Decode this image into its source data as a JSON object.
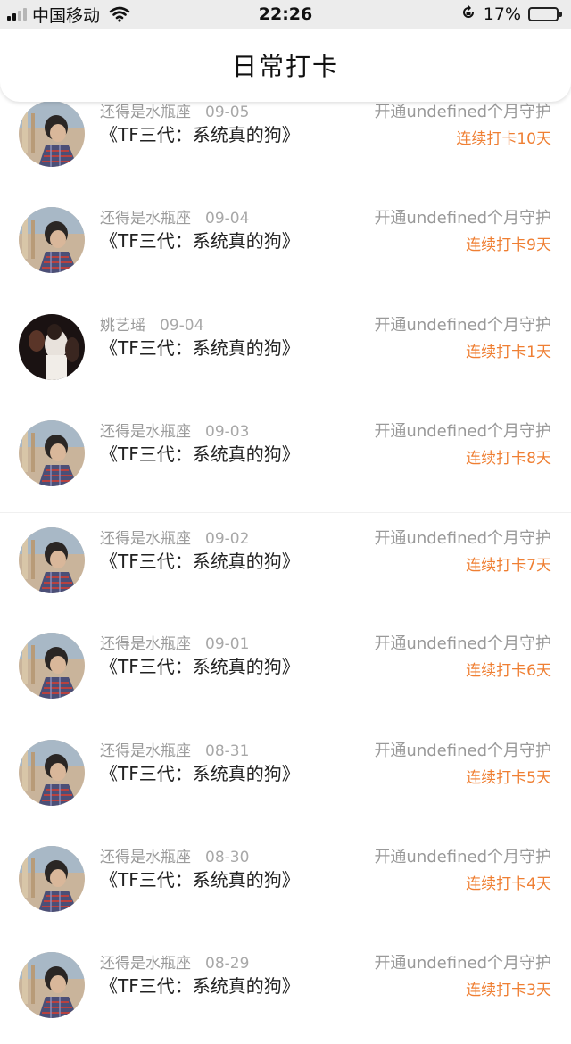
{
  "status_bar": {
    "carrier": "中国移动",
    "time": "22:26",
    "battery": "17%",
    "battery_level": 0.17
  },
  "header": {
    "title": "日常打卡"
  },
  "checkins": [
    {
      "user": "还得是水瓶座",
      "date": "09-05",
      "book": "《TF三代：系统真的狗》",
      "guard": "开通undefined个月守护",
      "streak": "连续打卡10天",
      "avatar": "avatar-photo-boy"
    },
    {
      "user": "还得是水瓶座",
      "date": "09-04",
      "book": "《TF三代：系统真的狗》",
      "guard": "开通undefined个月守护",
      "streak": "连续打卡9天",
      "avatar": "avatar-photo-boy"
    },
    {
      "user": "姚艺瑶",
      "date": "09-04",
      "book": "《TF三代：系统真的狗》",
      "guard": "开通undefined个月守护",
      "streak": "连续打卡1天",
      "avatar": "avatar-photo-dark"
    },
    {
      "user": "还得是水瓶座",
      "date": "09-03",
      "book": "《TF三代：系统真的狗》",
      "guard": "开通undefined个月守护",
      "streak": "连续打卡8天",
      "avatar": "avatar-photo-boy"
    },
    {
      "user": "还得是水瓶座",
      "date": "09-02",
      "book": "《TF三代：系统真的狗》",
      "guard": "开通undefined个月守护",
      "streak": "连续打卡7天",
      "avatar": "avatar-photo-boy"
    },
    {
      "user": "还得是水瓶座",
      "date": "09-01",
      "book": "《TF三代：系统真的狗》",
      "guard": "开通undefined个月守护",
      "streak": "连续打卡6天",
      "avatar": "avatar-photo-boy"
    },
    {
      "user": "还得是水瓶座",
      "date": "08-31",
      "book": "《TF三代：系统真的狗》",
      "guard": "开通undefined个月守护",
      "streak": "连续打卡5天",
      "avatar": "avatar-photo-boy"
    },
    {
      "user": "还得是水瓶座",
      "date": "08-30",
      "book": "《TF三代：系统真的狗》",
      "guard": "开通undefined个月守护",
      "streak": "连续打卡4天",
      "avatar": "avatar-photo-boy"
    },
    {
      "user": "还得是水瓶座",
      "date": "08-29",
      "book": "《TF三代：系统真的狗》",
      "guard": "开通undefined个月守护",
      "streak": "连续打卡3天",
      "avatar": "avatar-photo-boy"
    }
  ],
  "colors": {
    "streak": "#ef7f33",
    "meta": "#9b9b9b",
    "battery_fill": "#f5c40f"
  }
}
